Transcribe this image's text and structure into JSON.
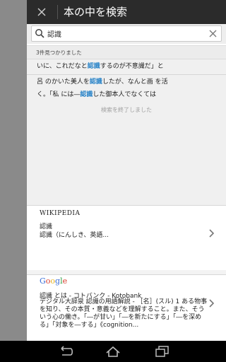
{
  "header": {
    "title": "本の中を検索"
  },
  "search": {
    "value": "認識",
    "placeholder": ""
  },
  "results": {
    "count_text": "3件見つかりました",
    "rows": [
      {
        "before": "いに、これだなと",
        "term": "認識",
        "after": "するのが不意識だ」と"
      },
      {
        "before": "呂 のかいた美人を",
        "term": "認識",
        "after": "したが、なんと画 を活"
      },
      {
        "before": "く。「私 には―",
        "term": "認識",
        "after": "した御本人でなくては"
      }
    ],
    "end_message": "検索を終了しました"
  },
  "wikipedia": {
    "logo_text": "WIKIPEDIA",
    "title": "認識",
    "snippet": "認識（にんしき、英語..."
  },
  "google": {
    "logo_letters": [
      "G",
      "o",
      "o",
      "g",
      "l",
      "e"
    ],
    "title": "認識 とは - コトバンク - Kotobank",
    "snippet": "デジタル大辞泉 認識の用語解説 - ［名］(スル) 1 ある物事を知り、その本質・意義などを理解すること。また、そういう心の働き。「―が甘い」「―を新たにする」「―を深める」「対象を―する」《cognition..."
  },
  "colors": {
    "highlight": "#2a84c8",
    "google": [
      "#3b6fd8",
      "#d83b2b",
      "#e9b21c",
      "#3b6fd8",
      "#2f9e46",
      "#d83b2b"
    ]
  },
  "icons": {
    "close": "close-icon",
    "search": "search-icon",
    "clear": "clear-icon",
    "chevron": "chevron-right-icon",
    "nav_back": "back-icon",
    "nav_home": "home-icon",
    "nav_recent": "recent-apps-icon"
  }
}
